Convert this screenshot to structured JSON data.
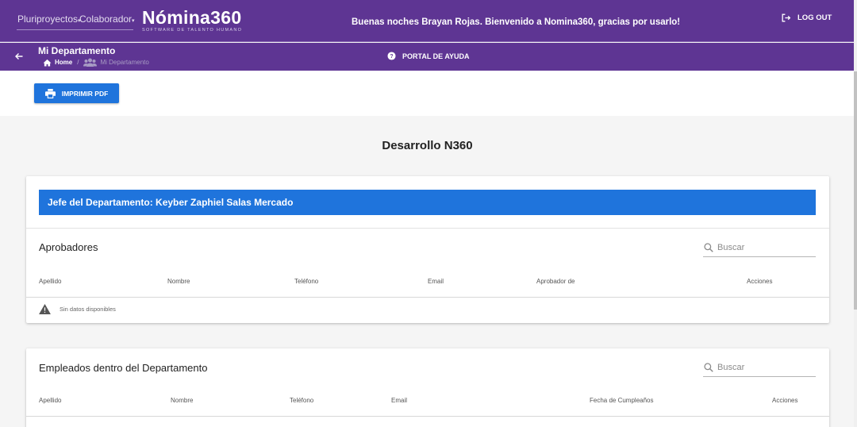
{
  "header": {
    "company": "Pluriproyectos",
    "profile": "Colaborador",
    "brand_name": "Nómina360",
    "brand_tagline": "SOFTWARE DE TALENTO HUMANO",
    "welcome": "Buenas noches Brayan Rojas. Bienvenido a Nomina360, gracias por usarlo!",
    "logout": "LOG OUT"
  },
  "subheader": {
    "title": "Mi Departamento",
    "breadcrumb": [
      "Home",
      "Mi Departamento"
    ],
    "help": "PORTAL DE AYUDA"
  },
  "toolbar": {
    "print_label": "IMPRIMIR PDF"
  },
  "department": {
    "name": "Desarrollo N360",
    "chief": "Jefe del Departamento: Keyber Zaphiel Salas Mercado"
  },
  "approvers": {
    "title": "Aprobadores",
    "search_placeholder": "Buscar",
    "columns": [
      "Apellido",
      "Nombre",
      "Teléfono",
      "Email",
      "Aprobador de",
      "Acciones"
    ],
    "empty": "Sin datos disponibles"
  },
  "employees": {
    "title": "Empleados dentro del Departamento",
    "search_placeholder": "Buscar",
    "columns": [
      "Apellido",
      "Nombre",
      "Teléfono",
      "Email",
      "Fecha de Cumpleaños",
      "Acciones"
    ]
  },
  "colors": {
    "header_bg": "#5e3593",
    "primary_blue": "#1f74dc"
  },
  "icons": [
    "back-arrow-icon",
    "home-icon",
    "group-icon",
    "help-icon",
    "logout-icon",
    "printer-icon",
    "search-icon",
    "warning-icon"
  ]
}
